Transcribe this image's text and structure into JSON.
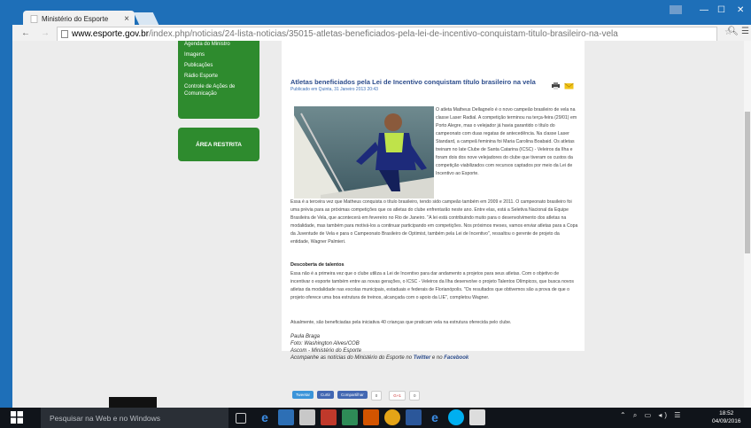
{
  "browser": {
    "tab_title": "Ministério do Esporte",
    "close_glyph": "×",
    "url_host": "www.esporte.gov.br",
    "url_path": "/index.php/noticias/24-lista-noticias/35015-atletas-beneficiados-pela-lei-de-incentivo-conquistam-titulo-brasileiro-na-vela",
    "window_controls": [
      "—",
      "☐",
      "✕"
    ]
  },
  "sidebar": {
    "items": [
      "Agenda do Ministro",
      "Imagens",
      "Publicações",
      "Rádio Esporte",
      "Controle de Ações de Comunicação"
    ],
    "restricted_area": "ÁREA RESTRITA"
  },
  "article": {
    "headline": "Atletas beneficiados pela Lei de Incentivo conquistam título brasileiro na vela",
    "published": "Publicado em Quinta, 31 Janeiro 2013 20:43",
    "para1": "O atleta Matheus Dellagnelo é o novo campeão brasileiro de vela na classe Laser Radial. A competição terminou na terça-feira (29/01) em Porto Alegre, mas o velejador já havia garantido o título do campeonato com duas regatas de antecedência. Na classe Laser Standard, a campeã feminina foi Maria Carolina Boabaid. Os atletas treinam no Iate Clube de Santa Catarina (ICSC) - Veleiros da Ilha e foram dois dos nove velejadores do clube que tiveram os custos da competição viabilizados com recursos captados por meio da Lei de Incentivo ao Esporte.",
    "para2": "Essa é a terceira vez que Matheus conquista o título brasileiro, tendo sido campeão também em 2009 e 2011. O campeonato brasileiro foi uma prévia para as próximas competições que os atletas do clube enfrentarão neste ano. Entre elas, está a Seletiva Nacional da Equipe Brasileira de Vela, que acontecerá em fevereiro no Rio de Janeiro. \"A lei está contribuindo muito para o desenvolvimento dos atletas na modalidade, mas também para motivá-los a continuar participando em competições. Nos próximos meses, vamos enviar atletas para a Copa da Juventude de Vela e para o Campeonato Brasileiro de Optimist, também pela Lei de Incentivo\", ressaltou o gerente de projeto da entidade, Wagner Palmieri.",
    "subhead": "Descoberta de talentos",
    "para3": "Essa não é a primeira vez que o clube utiliza a Lei de Incentivo para dar andamento a projetos para seus atletas. Com o objetivo de incentivar o esporte também entre as novas gerações, o ICSC - Veleiros da Ilha desenvolve o projeto Talentos Olímpicos, que busca novos atletas da modalidade nas escolas municipais, estaduais e federais de Florianópolis. \"Os resultados que obtivemos são a prova de que o projeto oferece uma boa estrutura de treinos, alcançada com o apoio da LIE\", completou Wagner.",
    "para4": "Atualmente, são beneficiadas pela iniciativa 40 crianças que praticam vela na estrutura oferecida pelo clube.",
    "sig1": "Paula Braga",
    "sig2": "Foto: Washington Alves/COB",
    "sig3": "Ascom - Ministério do Esporte",
    "sig4_prefix": "Acompanhe as notícias do Ministério do Esporte no ",
    "sig4_twitter": "Twitter",
    "sig4_and": " e no ",
    "sig4_facebook": "Facebook"
  },
  "share": {
    "tweet": "Tweetar",
    "facebook": "Curtir",
    "share": "Compartilhar",
    "count": "0",
    "gplus": "G+1",
    "gcount": "0"
  },
  "taskbar": {
    "search_placeholder": "Pesquisar na Web e no Windows",
    "time": "18:52",
    "date": "04/09/2016",
    "tray": "⌃ ⌕ ▭ ◂) ☰"
  },
  "colors": {
    "accent_green": "#2e8b2e",
    "link_blue": "#2d4d8c",
    "titlebar_blue": "#1e6fb8"
  }
}
